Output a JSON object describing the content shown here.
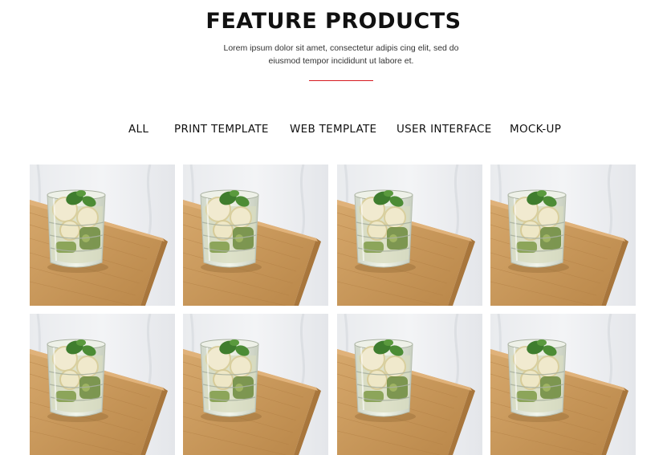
{
  "section": {
    "title": "FEATURE PRODUCTS",
    "subtitle": "Lorem ipsum dolor sit amet, consectetur adipis cing elit, sed do eiusmod tempor incididunt ut labore et."
  },
  "filters": [
    "ALL",
    "PRINT TEMPLATE",
    "WEB TEMPLATE",
    "USER INTERFACE",
    "MOCK-UP"
  ],
  "products": [
    {
      "image": "glass-of-lemon-water-on-wooden-tray"
    },
    {
      "image": "glass-of-lemon-water-on-wooden-tray"
    },
    {
      "image": "glass-of-lemon-water-on-wooden-tray"
    },
    {
      "image": "glass-of-lemon-water-on-wooden-tray"
    },
    {
      "image": "glass-of-lemon-water-on-wooden-tray"
    },
    {
      "image": "glass-of-lemon-water-on-wooden-tray"
    },
    {
      "image": "glass-of-lemon-water-on-wooden-tray"
    },
    {
      "image": "glass-of-lemon-water-on-wooden-tray"
    }
  ],
  "colors": {
    "accent": "#d71920",
    "wood": "#c99a5e",
    "backdrop": "#eceef0"
  }
}
